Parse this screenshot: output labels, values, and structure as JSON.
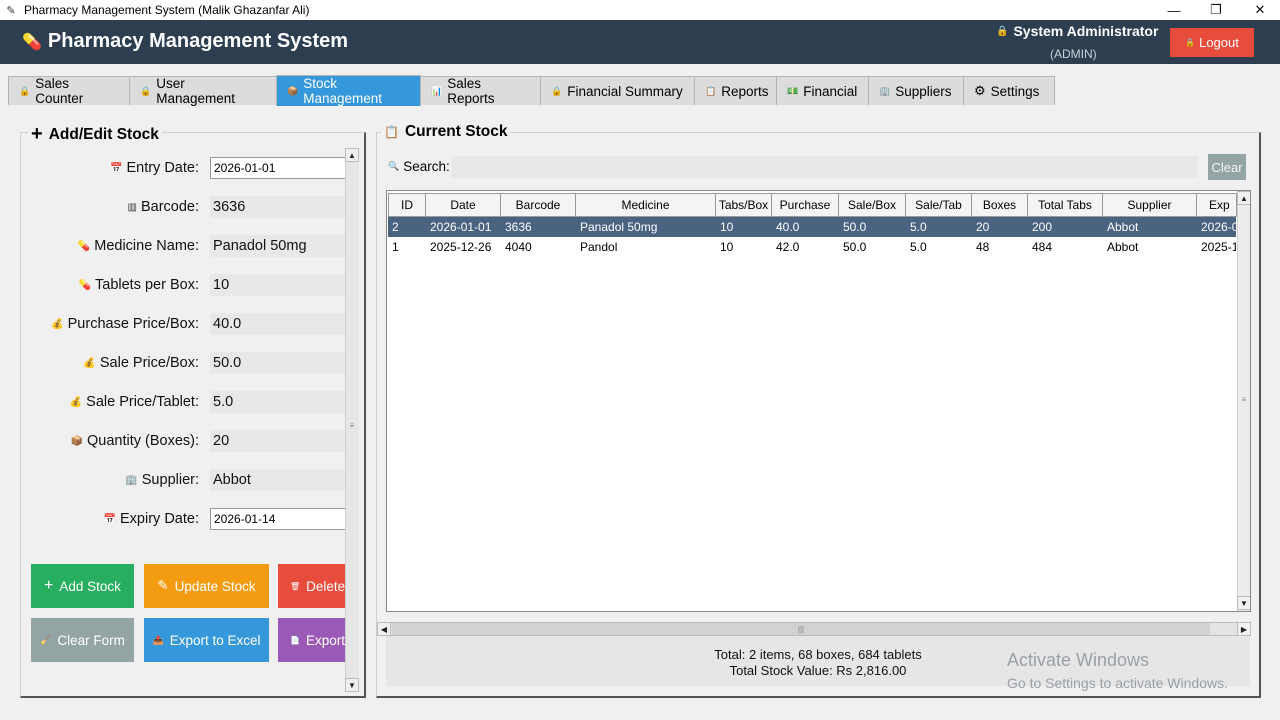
{
  "window": {
    "title": "Pharmacy Management System (Malik Ghazanfar Ali)",
    "minimize": "—",
    "restore": "❐",
    "close": "✕"
  },
  "header": {
    "brand": "Pharmacy Management System",
    "user": "System Administrator",
    "role": "(ADMIN)",
    "logout": "Logout"
  },
  "tabs": [
    {
      "label": "Sales Counter",
      "icon": "lock-icon"
    },
    {
      "label": "User Management",
      "icon": "lock-icon"
    },
    {
      "label": "Stock Management",
      "icon": "box-icon",
      "active": true
    },
    {
      "label": "Sales Reports",
      "icon": "chart-icon"
    },
    {
      "label": "Financial Summary",
      "icon": "lock-icon"
    },
    {
      "label": "Reports",
      "icon": "report-icon"
    },
    {
      "label": "Financial",
      "icon": "money-icon"
    },
    {
      "label": "Suppliers",
      "icon": "supplier-icon"
    },
    {
      "label": "Settings",
      "icon": "gear-icon"
    }
  ],
  "form": {
    "title": "Add/Edit Stock",
    "fields": [
      {
        "label": "Entry Date:",
        "value": "2026-01-01",
        "type": "date",
        "icon": "calendar-icon"
      },
      {
        "label": "Barcode:",
        "value": "3636",
        "icon": "barcode-icon"
      },
      {
        "label": "Medicine Name:",
        "value": "Panadol 50mg",
        "icon": "pill-icon"
      },
      {
        "label": "Tablets per Box:",
        "value": "10",
        "icon": "pill-icon"
      },
      {
        "label": "Purchase Price/Box:",
        "value": "40.0",
        "icon": "money-bag-icon"
      },
      {
        "label": "Sale Price/Box:",
        "value": "50.0",
        "icon": "money-bag-icon"
      },
      {
        "label": "Sale Price/Tablet:",
        "value": "5.0",
        "icon": "money-bag-icon"
      },
      {
        "label": "Quantity (Boxes):",
        "value": "20",
        "icon": "box-icon"
      },
      {
        "label": "Supplier:",
        "value": "Abbot",
        "icon": "building-icon"
      },
      {
        "label": "Expiry Date:",
        "value": "2026-01-14",
        "type": "date",
        "icon": "calendar-icon"
      }
    ],
    "buttons": {
      "add": "Add Stock",
      "update": "Update Stock",
      "delete": "Delete",
      "clear": "Clear Form",
      "export_excel": "Export to Excel",
      "export": "Export"
    }
  },
  "stock": {
    "title": "Current Stock",
    "search_label": "Search:",
    "clear": "Clear",
    "columns": [
      "ID",
      "Date",
      "Barcode",
      "Medicine",
      "Tabs/Box",
      "Purchase",
      "Sale/Box",
      "Sale/Tab",
      "Boxes",
      "Total Tabs",
      "Supplier",
      "Exp"
    ],
    "rows": [
      [
        "2",
        "2026-01-01",
        "3636",
        "Panadol 50mg",
        "10",
        "40.0",
        "50.0",
        "5.0",
        "20",
        "200",
        "Abbot",
        "2026-0"
      ],
      [
        "1",
        "2025-12-26",
        "4040",
        "Pandol",
        "10",
        "42.0",
        "50.0",
        "5.0",
        "48",
        "484",
        "Abbot",
        "2025-1"
      ]
    ],
    "total_line": "Total: 2 items, 68 boxes, 684 tablets",
    "value_line": "Total Stock Value: Rs 2,816.00"
  },
  "watermark": {
    "line1": "Activate Windows",
    "line2": "Go to Settings to activate Windows."
  },
  "colors": {
    "header": "#2c3e50",
    "active_tab": "#3498db",
    "logout": "#e74c3c",
    "add": "#27ae60",
    "update": "#f39c12",
    "delete": "#e74c3c",
    "clear": "#95a5a6",
    "export_excel": "#3498db",
    "export": "#9b59b6",
    "selected_row": "#4a6380"
  }
}
